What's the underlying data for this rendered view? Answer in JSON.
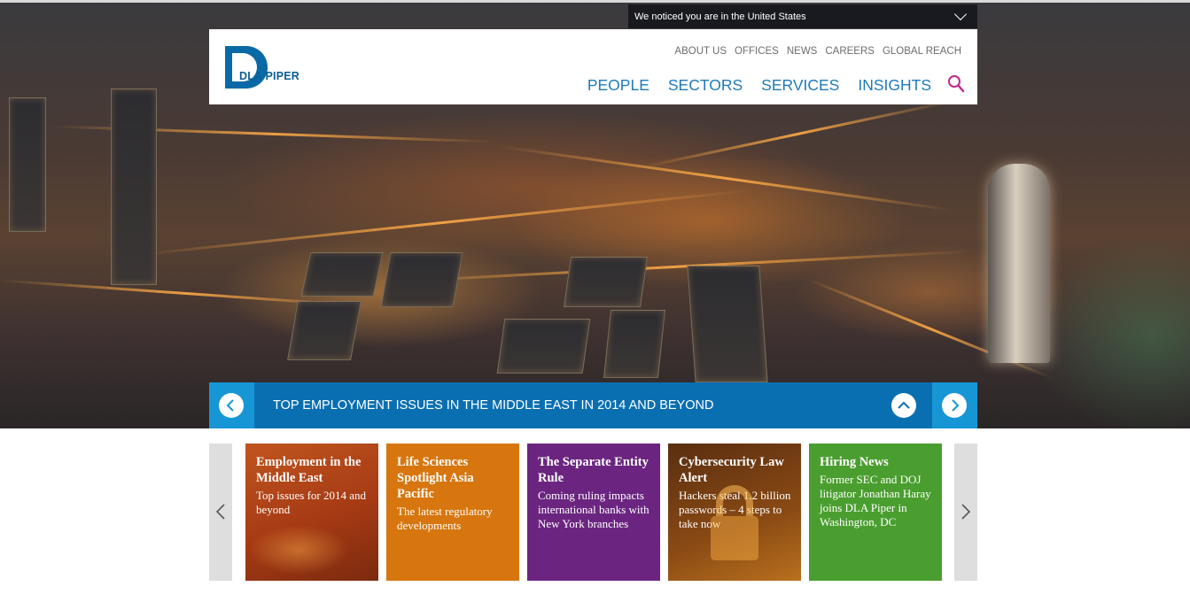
{
  "notice": {
    "text": "We noticed you are in the United States"
  },
  "logo": {
    "text": "DLA PIPER"
  },
  "utility_nav": [
    "ABOUT US",
    "OFFICES",
    "NEWS",
    "CAREERS",
    "GLOBAL REACH"
  ],
  "main_nav": [
    "PEOPLE",
    "SECTORS",
    "SERVICES",
    "INSIGHTS"
  ],
  "banner": {
    "title": "TOP EMPLOYMENT ISSUES IN THE MIDDLE EAST IN 2014 AND BEYOND"
  },
  "tiles": [
    {
      "title": "Employment in the Middle East",
      "text": "Top issues for 2014 and beyond",
      "color": "#b9471a"
    },
    {
      "title": "Life Sciences Spotlight Asia Pacific",
      "text": "The latest regulatory developments",
      "color": "#d7760f"
    },
    {
      "title": "The Separate Entity Rule",
      "text": "Coming ruling impacts international banks with New York branches",
      "color": "#6b2580"
    },
    {
      "title": "Cybersecurity Law Alert",
      "text": "Hackers steal 1.2 billion passwords – 4 steps to take now",
      "color": "#7a3f12"
    },
    {
      "title": "Hiring News",
      "text": "Former SEC and DOJ litigator Jonathan Haray joins DLA Piper in Washington, DC",
      "color": "#4a9e2f"
    }
  ],
  "colors": {
    "brand_blue": "#0a6fb1",
    "accent_blue": "#1796d6",
    "search_magenta": "#c0288a"
  },
  "icons": [
    "chevron-down-icon",
    "search-icon",
    "arrow-left-icon",
    "arrow-right-icon",
    "chevron-up-icon"
  ]
}
